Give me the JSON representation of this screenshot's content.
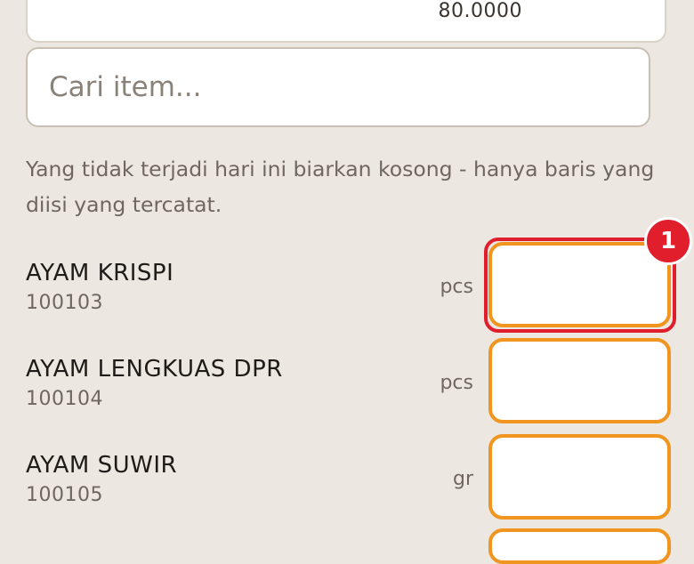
{
  "top_field": {
    "value": "80.0000"
  },
  "search": {
    "placeholder": "Cari item..."
  },
  "hint": "Yang tidak terjadi hari ini biarkan kosong - hanya baris yang diisi yang tercatat.",
  "items": [
    {
      "name": "AYAM KRISPI",
      "code": "100103",
      "unit": "pcs",
      "value": ""
    },
    {
      "name": "AYAM LENGKUAS DPR",
      "code": "100104",
      "unit": "pcs",
      "value": ""
    },
    {
      "name": "AYAM SUWIR",
      "code": "100105",
      "unit": "gr",
      "value": ""
    }
  ],
  "annotation": {
    "badge": "1",
    "color": "#e01e2c"
  },
  "colors": {
    "background": "#ece8e1",
    "input_border": "#f0951f",
    "highlight": "#e01e2c"
  }
}
